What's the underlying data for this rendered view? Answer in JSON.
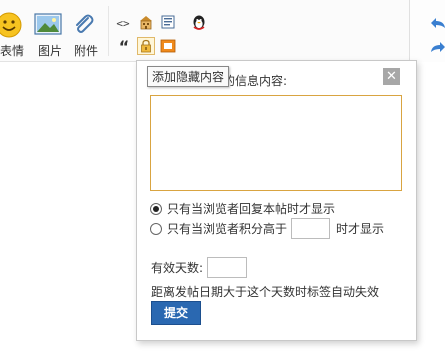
{
  "toolbar": {
    "emoji_label": "表情",
    "image_label": "图片",
    "attachment_label": "附件",
    "icons": [
      "emoji-icon",
      "image-icon",
      "attachment-icon",
      "code-icon",
      "building-icon",
      "doc-icon",
      "penguin-icon",
      "quote-icon",
      "lock-icon",
      "media-icon",
      "undo-icon",
      "redo-icon"
    ],
    "quote_glyph": "“",
    "code_glyph": "<>"
  },
  "tooltip": {
    "text": "添加隐藏内容"
  },
  "popup": {
    "title": "请输入要隐藏的信息内容:",
    "close_glyph": "✕",
    "content_value": "",
    "radio_reply_label": "只有当浏览者回复本帖时才显示",
    "radio_reply_checked": true,
    "radio_points_label_prefix": "只有当浏览者积分高于",
    "radio_points_label_suffix": "时才显示",
    "radio_points_checked": false,
    "points_value": "",
    "valid_days_label": "有效天数:",
    "valid_days_value": "",
    "expire_note": "距离发帖日期大于这个天数时标签自动失效",
    "submit_label": "提交"
  },
  "colors": {
    "accent_border": "#d9a441",
    "submit_bg": "#2a68b1",
    "arrow_blue": "#3a7fd0"
  }
}
